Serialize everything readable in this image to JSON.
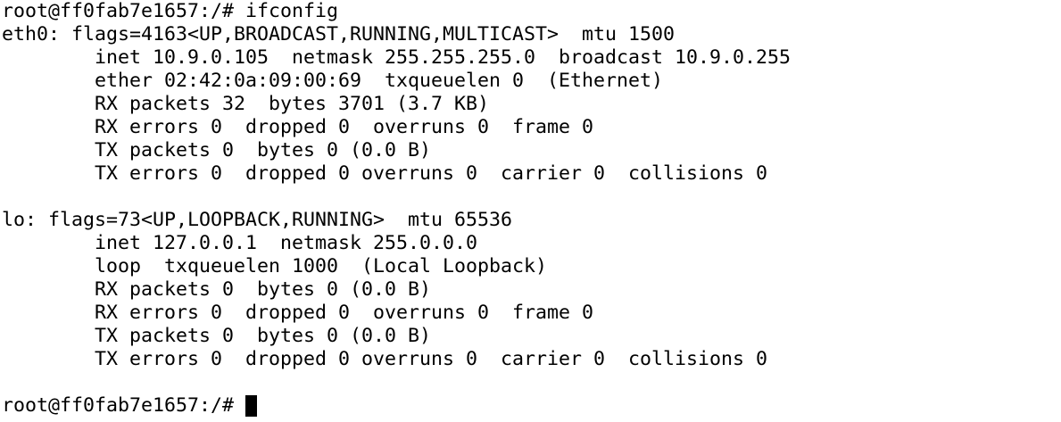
{
  "terminal": {
    "lines": [
      "root@ff0fab7e1657:/# ifconfig",
      "eth0: flags=4163<UP,BROADCAST,RUNNING,MULTICAST>  mtu 1500",
      "        inet 10.9.0.105  netmask 255.255.255.0  broadcast 10.9.0.255",
      "        ether 02:42:0a:09:00:69  txqueuelen 0  (Ethernet)",
      "        RX packets 32  bytes 3701 (3.7 KB)",
      "        RX errors 0  dropped 0  overruns 0  frame 0",
      "        TX packets 0  bytes 0 (0.0 B)",
      "        TX errors 0  dropped 0 overruns 0  carrier 0  collisions 0",
      "",
      "lo: flags=73<UP,LOOPBACK,RUNNING>  mtu 65536",
      "        inet 127.0.0.1  netmask 255.0.0.0",
      "        loop  txqueuelen 1000  (Local Loopback)",
      "        RX packets 0  bytes 0 (0.0 B)",
      "        RX errors 0  dropped 0  overruns 0  frame 0",
      "        TX packets 0  bytes 0 (0.0 B)",
      "        TX errors 0  dropped 0 overruns 0  carrier 0  collisions 0",
      ""
    ],
    "prompt": "root@ff0fab7e1657:/# "
  }
}
